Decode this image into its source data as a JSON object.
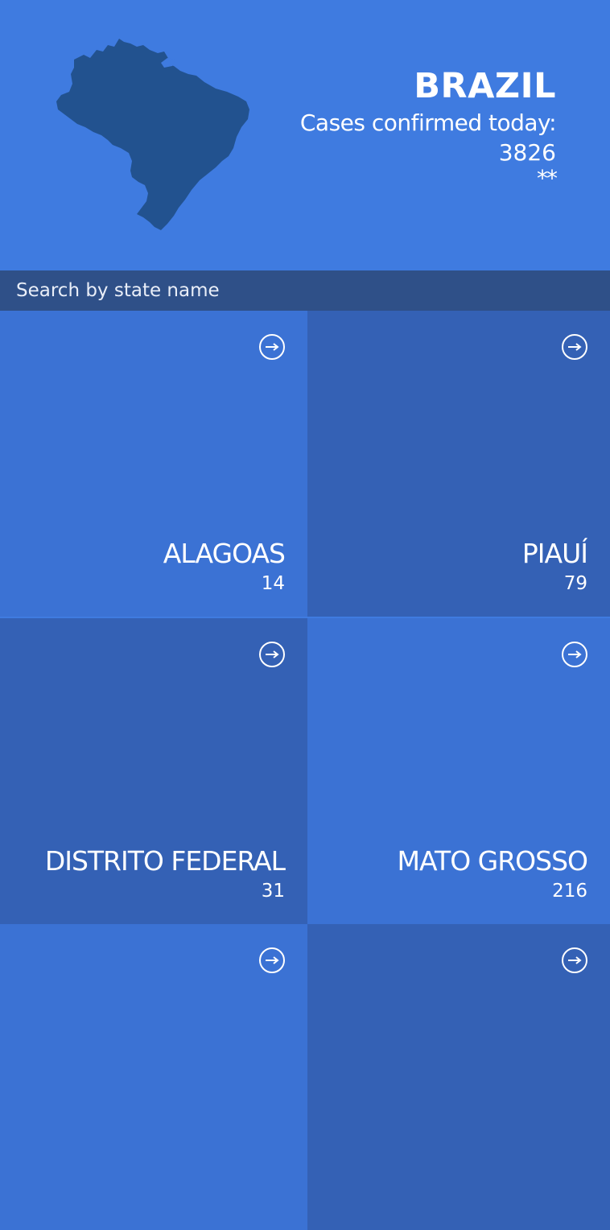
{
  "header": {
    "country": "BRAZIL",
    "today_label": "Cases confirmed today:",
    "today_value": "3826",
    "note": "**",
    "map_icon": "brazil-map-silhouette"
  },
  "search": {
    "placeholder": "Search by state name",
    "value": ""
  },
  "states": [
    {
      "name": "ALAGOAS",
      "count": "14",
      "icon": "arrow-right-circle-icon"
    },
    {
      "name": "PIAUÍ",
      "count": "79",
      "icon": "arrow-right-circle-icon"
    },
    {
      "name": "DISTRITO FEDERAL",
      "count": "31",
      "icon": "arrow-right-circle-icon"
    },
    {
      "name": "MATO GROSSO",
      "count": "216",
      "icon": "arrow-right-circle-icon"
    },
    {
      "name": "",
      "count": "",
      "icon": "arrow-right-circle-icon"
    },
    {
      "name": "",
      "count": "",
      "icon": "arrow-right-circle-icon"
    }
  ],
  "colors": {
    "header_bg": "#3f7be0",
    "search_bg": "#2f5088",
    "tile_light": "#3b72d4",
    "tile_dark": "#3461b5",
    "map_fill": "#22528f"
  }
}
